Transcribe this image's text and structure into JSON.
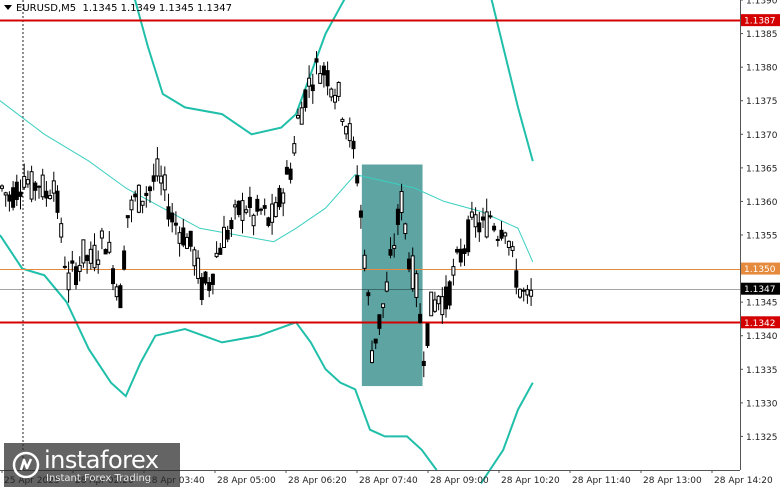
{
  "header": {
    "symbol": "EURUSD,M5",
    "ohlc": "1.1345 1.1349 1.1345 1.1347"
  },
  "watermark": {
    "brand": "instaforex",
    "tagline": "Instant Forex Trading"
  },
  "colors": {
    "background": "#ffffff",
    "grid": "#d6d6d6",
    "candle": "#000000",
    "bands": "#1fbfaa",
    "ma": "#3ccfc0",
    "resistance": "#d40000",
    "support": "#d40000",
    "orange": "#e58a3c",
    "zone": "#2f8a89",
    "current": "#000000",
    "axis": "#555555"
  },
  "chart_data": {
    "type": "candlestick",
    "symbol": "EURUSD",
    "timeframe": "M5",
    "ylim": [
      1.132,
      1.139
    ],
    "y_ticks": [
      "1.1390",
      "1.1385",
      "1.1380",
      "1.1375",
      "1.1370",
      "1.1365",
      "1.1360",
      "1.1355",
      "1.1345",
      "1.1340",
      "1.1335",
      "1.1330",
      "1.1325"
    ],
    "x_ticks": [
      "25 Apr 2025",
      "28 Apr 02:20",
      "28 Apr 03:40",
      "28 Apr 05:00",
      "28 Apr 06:20",
      "28 Apr 07:40",
      "28 Apr 09:00",
      "28 Apr 10:20",
      "28 Apr 11:40",
      "28 Apr 13:00",
      "28 Apr 14:20"
    ],
    "levels": [
      {
        "name": "resistance",
        "value": 1.1387,
        "label": "1.1387",
        "color": "#d40000"
      },
      {
        "name": "orange",
        "value": 1.135,
        "label": "1.1350",
        "color": "#e58a3c"
      },
      {
        "name": "current",
        "value": 1.1347,
        "label": "1.1347",
        "color": "#000000"
      },
      {
        "name": "support",
        "value": 1.1342,
        "label": "1.1342",
        "color": "#d40000"
      }
    ],
    "zone": {
      "x_from": 0.489,
      "x_to": 0.571,
      "y_from": 1.13325,
      "y_to": 1.13655
    },
    "series": [
      {
        "name": "price",
        "points": [
          [
            0.0,
            1.1362
          ],
          [
            0.01,
            1.13605
          ],
          [
            0.02,
            1.1362
          ],
          [
            0.03,
            1.1364
          ],
          [
            0.04,
            1.1362
          ],
          [
            0.05,
            1.1363
          ],
          [
            0.06,
            1.1361
          ],
          [
            0.07,
            1.13635
          ],
          [
            0.08,
            1.1355
          ],
          [
            0.09,
            1.1348
          ],
          [
            0.1,
            1.135
          ],
          [
            0.11,
            1.1352
          ],
          [
            0.12,
            1.1351
          ],
          [
            0.13,
            1.1353
          ],
          [
            0.14,
            1.13545
          ],
          [
            0.15,
            1.135
          ],
          [
            0.16,
            1.1346
          ],
          [
            0.17,
            1.1358
          ],
          [
            0.18,
            1.136
          ],
          [
            0.19,
            1.1361
          ],
          [
            0.2,
            1.1362
          ],
          [
            0.21,
            1.1364
          ],
          [
            0.22,
            1.13615
          ],
          [
            0.23,
            1.13575
          ],
          [
            0.24,
            1.1356
          ],
          [
            0.25,
            1.13545
          ],
          [
            0.26,
            1.1352
          ],
          [
            0.27,
            1.1347
          ],
          [
            0.28,
            1.1348
          ],
          [
            0.29,
            1.1352
          ],
          [
            0.3,
            1.1355
          ],
          [
            0.31,
            1.1356
          ],
          [
            0.32,
            1.13585
          ],
          [
            0.33,
            1.13595
          ],
          [
            0.34,
            1.13575
          ],
          [
            0.35,
            1.13585
          ],
          [
            0.36,
            1.1357
          ],
          [
            0.37,
            1.1358
          ],
          [
            0.38,
            1.1362
          ],
          [
            0.39,
            1.1365
          ],
          [
            0.4,
            1.1372
          ],
          [
            0.41,
            1.1376
          ],
          [
            0.42,
            1.1379
          ],
          [
            0.43,
            1.138
          ],
          [
            0.44,
            1.1379
          ],
          [
            0.45,
            1.1377
          ],
          [
            0.46,
            1.1374
          ],
          [
            0.47,
            1.137
          ],
          [
            0.48,
            1.1364
          ],
          [
            0.49,
            1.1352
          ],
          [
            0.5,
            1.1338
          ],
          [
            0.51,
            1.1342
          ],
          [
            0.52,
            1.1347
          ],
          [
            0.53,
            1.1354
          ],
          [
            0.54,
            1.136
          ],
          [
            0.55,
            1.1352
          ],
          [
            0.56,
            1.1347
          ],
          [
            0.57,
            1.1338
          ],
          [
            0.58,
            1.1344
          ],
          [
            0.59,
            1.1346
          ],
          [
            0.6,
            1.1345
          ],
          [
            0.61,
            1.1349
          ],
          [
            0.62,
            1.1352
          ],
          [
            0.63,
            1.1355
          ],
          [
            0.64,
            1.1357
          ],
          [
            0.65,
            1.1356
          ],
          [
            0.66,
            1.1358
          ],
          [
            0.67,
            1.1356
          ],
          [
            0.68,
            1.1357
          ],
          [
            0.69,
            1.1351
          ],
          [
            0.7,
            1.1347
          ],
          [
            0.71,
            1.1345
          ],
          [
            0.72,
            1.1346
          ]
        ]
      },
      {
        "name": "moving-average",
        "points": [
          [
            0.0,
            1.1375
          ],
          [
            0.06,
            1.137
          ],
          [
            0.12,
            1.1366
          ],
          [
            0.17,
            1.1362
          ],
          [
            0.22,
            1.1359
          ],
          [
            0.27,
            1.1356
          ],
          [
            0.32,
            1.1355
          ],
          [
            0.37,
            1.1354
          ],
          [
            0.4,
            1.1356
          ],
          [
            0.44,
            1.1359
          ],
          [
            0.48,
            1.1364
          ],
          [
            0.52,
            1.1363
          ],
          [
            0.56,
            1.1362
          ],
          [
            0.6,
            1.136
          ],
          [
            0.65,
            1.13585
          ],
          [
            0.7,
            1.1356
          ],
          [
            0.72,
            1.1351
          ]
        ]
      },
      {
        "name": "upper-band",
        "points": [
          [
            0.18,
            1.1391
          ],
          [
            0.2,
            1.1383
          ],
          [
            0.22,
            1.1376
          ],
          [
            0.25,
            1.1374
          ],
          [
            0.3,
            1.1373
          ],
          [
            0.34,
            1.137
          ],
          [
            0.38,
            1.1371
          ],
          [
            0.4,
            1.1373
          ],
          [
            0.42,
            1.1379
          ],
          [
            0.44,
            1.1385
          ],
          [
            0.46,
            1.1389
          ],
          [
            0.48,
            1.1393
          ]
        ]
      },
      {
        "name": "upper-band",
        "points": [
          [
            0.66,
            1.1392
          ],
          [
            0.68,
            1.1383
          ],
          [
            0.7,
            1.1374
          ],
          [
            0.72,
            1.1366
          ]
        ]
      },
      {
        "name": "lower-band",
        "points": [
          [
            0.0,
            1.1355
          ],
          [
            0.03,
            1.135
          ],
          [
            0.06,
            1.1349
          ],
          [
            0.09,
            1.1345
          ],
          [
            0.12,
            1.1338
          ],
          [
            0.15,
            1.1333
          ],
          [
            0.17,
            1.1331
          ],
          [
            0.19,
            1.1336
          ],
          [
            0.21,
            1.134
          ],
          [
            0.25,
            1.1341
          ],
          [
            0.3,
            1.1339
          ],
          [
            0.35,
            1.134
          ],
          [
            0.4,
            1.1342
          ],
          [
            0.42,
            1.1339
          ],
          [
            0.44,
            1.1335
          ],
          [
            0.46,
            1.1333
          ],
          [
            0.48,
            1.1332
          ],
          [
            0.5,
            1.1326
          ],
          [
            0.52,
            1.1325
          ],
          [
            0.55,
            1.1325
          ],
          [
            0.57,
            1.1323
          ],
          [
            0.59,
            1.132
          ]
        ]
      },
      {
        "name": "lower-band",
        "points": [
          [
            0.65,
            1.1318
          ],
          [
            0.68,
            1.1323
          ],
          [
            0.7,
            1.1329
          ],
          [
            0.72,
            1.1333
          ]
        ]
      }
    ]
  }
}
